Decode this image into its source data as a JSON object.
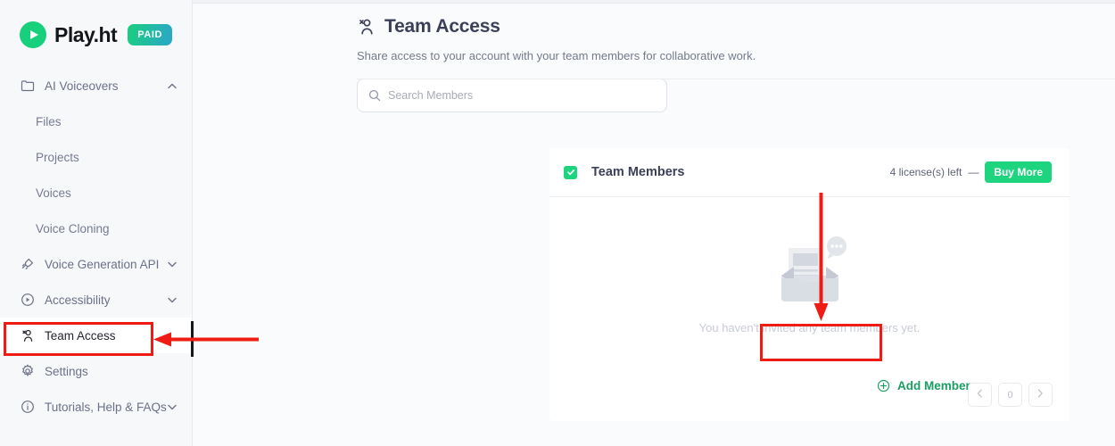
{
  "brand": {
    "name": "Play.ht",
    "badge": "PAID",
    "logo_icon": "play-circle-icon",
    "logo_color": "#17d07b",
    "badge_gradient_from": "#19cf7e",
    "badge_gradient_to": "#2ca6c9"
  },
  "sidebar": {
    "items": [
      {
        "label": "AI Voiceovers",
        "icon": "folder-icon",
        "sub": false,
        "chevron": "up",
        "active": false
      },
      {
        "label": "Files",
        "icon": "",
        "sub": true,
        "chevron": "",
        "active": false
      },
      {
        "label": "Projects",
        "icon": "",
        "sub": true,
        "chevron": "",
        "active": false
      },
      {
        "label": "Voices",
        "icon": "",
        "sub": true,
        "chevron": "",
        "active": false
      },
      {
        "label": "Voice Cloning",
        "icon": "",
        "sub": true,
        "chevron": "",
        "active": false
      },
      {
        "label": "Voice Generation API",
        "icon": "plug-icon",
        "sub": false,
        "chevron": "down",
        "active": false
      },
      {
        "label": "Accessibility",
        "icon": "accessibility-icon",
        "sub": false,
        "chevron": "down",
        "active": false
      },
      {
        "label": "Team Access",
        "icon": "team-icon",
        "sub": false,
        "chevron": "",
        "active": true
      },
      {
        "label": "Settings",
        "icon": "gear-icon",
        "sub": false,
        "chevron": "",
        "active": false
      },
      {
        "label": "Tutorials, Help & FAQs",
        "icon": "info-icon",
        "sub": false,
        "chevron": "down",
        "active": false
      }
    ]
  },
  "page": {
    "title": "Team Access",
    "title_icon": "team-icon",
    "subtitle": "Share access to your account with your team members for collaborative work."
  },
  "search": {
    "placeholder": "Search Members",
    "value": "",
    "icon": "search-icon"
  },
  "card": {
    "checkbox_icon": "check-icon",
    "checkbox_checked": true,
    "title": "Team Members",
    "license_text": "4 license(s) left",
    "license_dash": "—",
    "buy_more_label": "Buy More",
    "buy_more_color": "#1ed47f",
    "empty_text": "You haven't invited any team members yet.",
    "empty_illustration": "inbox-message-icon",
    "add_members_label": "Add Members",
    "add_members_icon": "plus-circle-icon",
    "add_members_color": "#1a9e62"
  },
  "pagination": {
    "prev_icon": "chevron-left-icon",
    "page": "0",
    "next_icon": "chevron-right-icon"
  },
  "annotations": {
    "highlight_color": "#ee1c15",
    "arrow_color": "#ee1c15",
    "caret_color": "#18181c"
  }
}
